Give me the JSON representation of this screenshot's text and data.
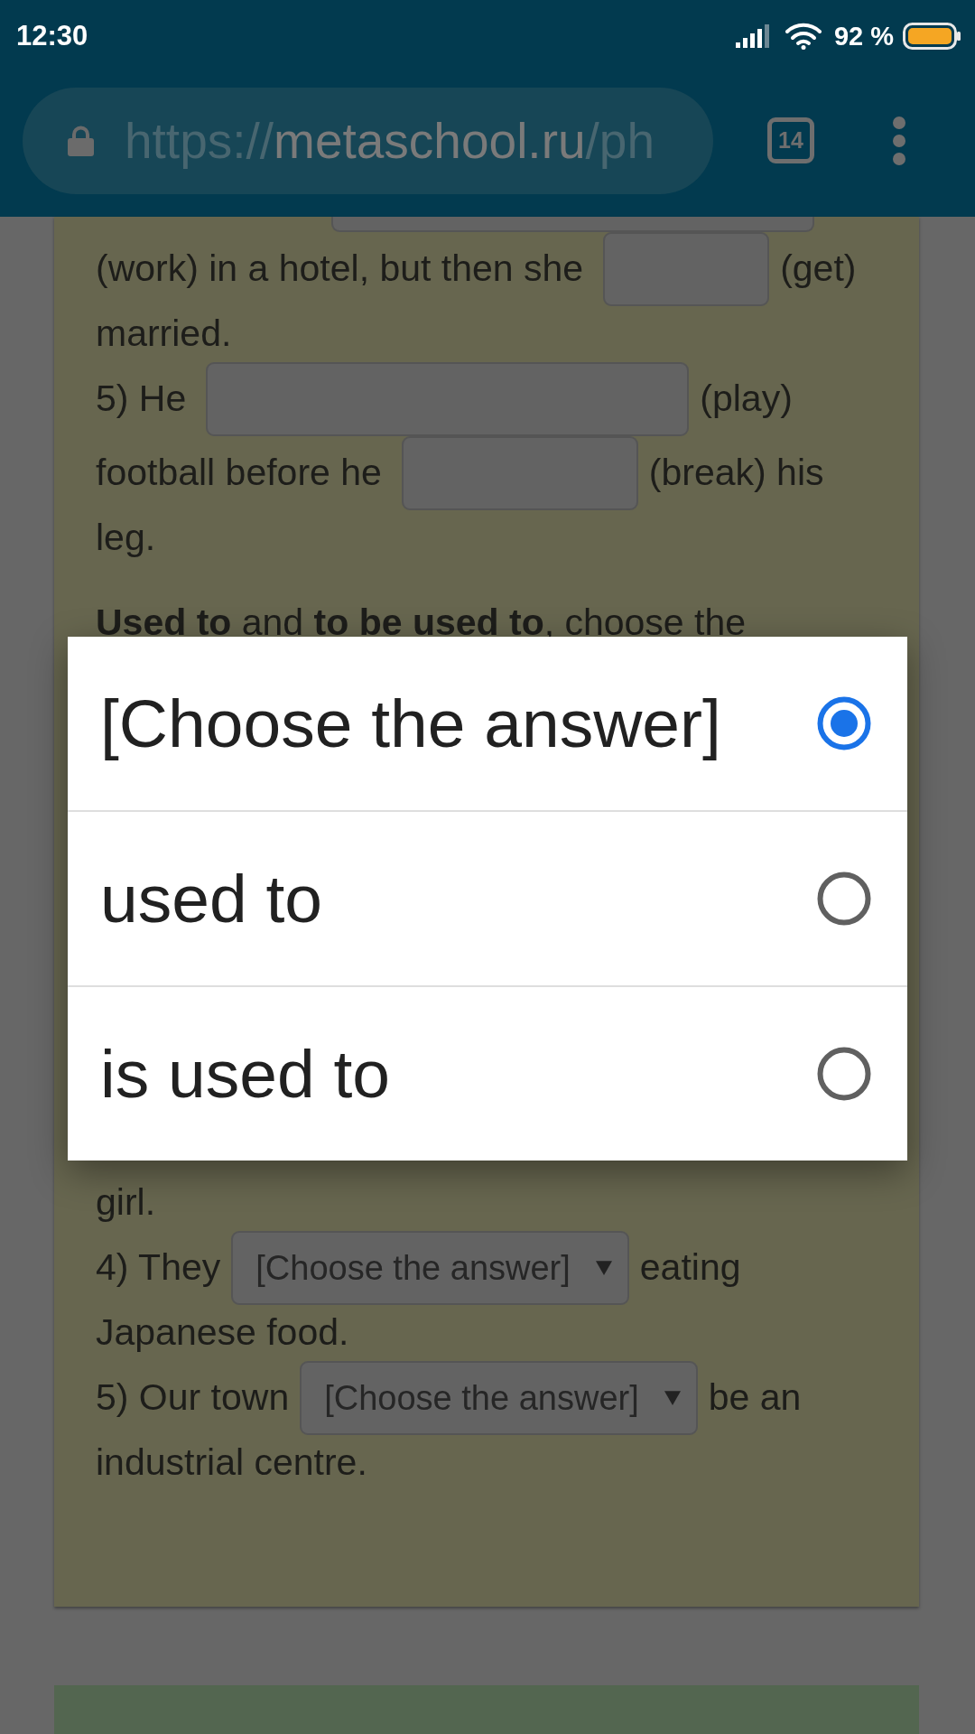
{
  "status_bar": {
    "time": "12:30",
    "battery": "92 %"
  },
  "browser_bar": {
    "url": {
      "scheme": "https://",
      "host": "metaschool.ru",
      "path": "/ph"
    },
    "tab_count": "14"
  },
  "exercise_1": {
    "lines": [
      [
        {
          "kind": "cutblank"
        }
      ],
      [
        {
          "kind": "text",
          "text": "(work) in a hotel, but then she"
        },
        {
          "kind": "narrowblank"
        },
        {
          "kind": "text",
          "text": "(get)"
        }
      ],
      [
        {
          "kind": "text",
          "text": "married."
        }
      ],
      [
        {
          "kind": "text",
          "text": "5) He"
        },
        {
          "kind": "wideblank"
        },
        {
          "kind": "text",
          "text": "(play)"
        }
      ],
      [
        {
          "kind": "text",
          "text": "football before he"
        },
        {
          "kind": "blank"
        },
        {
          "kind": "text",
          "text": "(break) his"
        }
      ],
      [
        {
          "kind": "text",
          "text": "leg."
        }
      ]
    ]
  },
  "exercise_2": {
    "heading": "**Used to** and **to be used to**, choose the",
    "lines": [
      [
        {
          "kind": "text",
          "text": "girl."
        }
      ],
      [
        {
          "kind": "text",
          "text": "4) They"
        },
        {
          "kind": "select",
          "value": "[Choose the answer]"
        },
        {
          "kind": "text",
          "text": "eating"
        }
      ],
      [
        {
          "kind": "text",
          "text": "Japanese food."
        }
      ],
      [
        {
          "kind": "text",
          "text": "5) Our town"
        },
        {
          "kind": "select",
          "value": "[Choose the answer]"
        },
        {
          "kind": "text",
          "text": "be an"
        }
      ],
      [
        {
          "kind": "text",
          "text": "industrial centre."
        }
      ]
    ]
  },
  "picker": {
    "options": [
      {
        "label": "[Choose the answer]",
        "selected": true
      },
      {
        "label": "used to",
        "selected": false
      },
      {
        "label": "is used to",
        "selected": false
      }
    ]
  }
}
